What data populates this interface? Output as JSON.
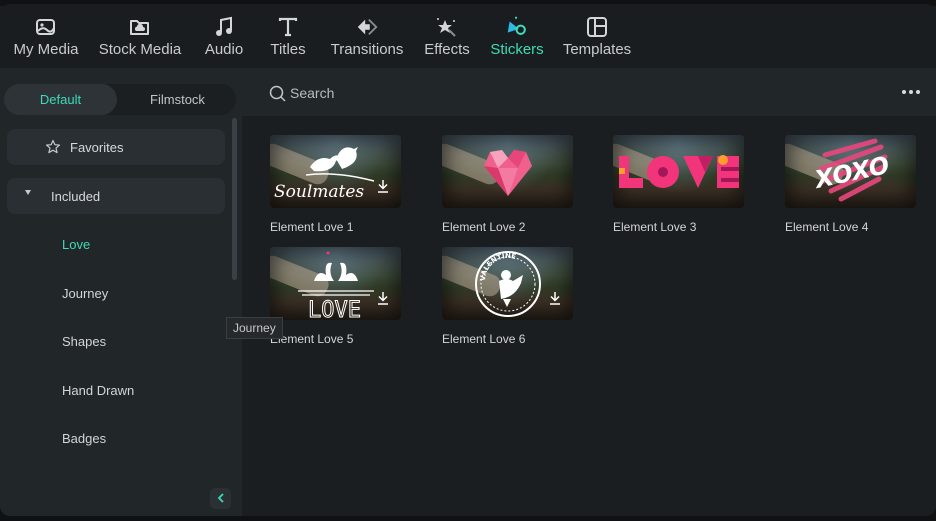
{
  "topnav": {
    "items": [
      {
        "label": "My Media",
        "icon": "my-media-icon",
        "active": false
      },
      {
        "label": "Stock Media",
        "icon": "stock-media-icon",
        "active": false
      },
      {
        "label": "Audio",
        "icon": "music-note-icon",
        "active": false
      },
      {
        "label": "Titles",
        "icon": "titles-icon",
        "active": false
      },
      {
        "label": "Transitions",
        "icon": "transitions-icon",
        "active": false
      },
      {
        "label": "Effects",
        "icon": "effects-icon",
        "active": false
      },
      {
        "label": "Stickers",
        "icon": "stickers-icon",
        "active": true
      },
      {
        "label": "Templates",
        "icon": "templates-icon",
        "active": false
      }
    ],
    "accent_color": "#3ddbb8"
  },
  "sidebar": {
    "segments": [
      {
        "label": "Default",
        "active": true
      },
      {
        "label": "Filmstock",
        "active": false
      }
    ],
    "favorites_label": "Favorites",
    "included_label": "Included",
    "categories": [
      {
        "label": "Love",
        "active": true
      },
      {
        "label": "Journey",
        "active": false
      },
      {
        "label": "Shapes",
        "active": false
      },
      {
        "label": "Hand Drawn",
        "active": false
      },
      {
        "label": "Badges",
        "active": false
      }
    ]
  },
  "search": {
    "placeholder": "Search",
    "value": ""
  },
  "tooltip": {
    "text": "Journey"
  },
  "stickers": [
    {
      "title": "Element Love 1",
      "art": "soulmates-birds",
      "downloadable": true
    },
    {
      "title": "Element Love 2",
      "art": "polygon-heart",
      "downloadable": false
    },
    {
      "title": "Element Love 3",
      "art": "love-blocks",
      "downloadable": false
    },
    {
      "title": "Element Love 4",
      "art": "xoxo-scribble",
      "downloadable": false
    },
    {
      "title": "Element Love 5",
      "art": "swans-love",
      "downloadable": true
    },
    {
      "title": "Element Love 6",
      "art": "valentine-cupid-badge",
      "downloadable": true
    }
  ]
}
